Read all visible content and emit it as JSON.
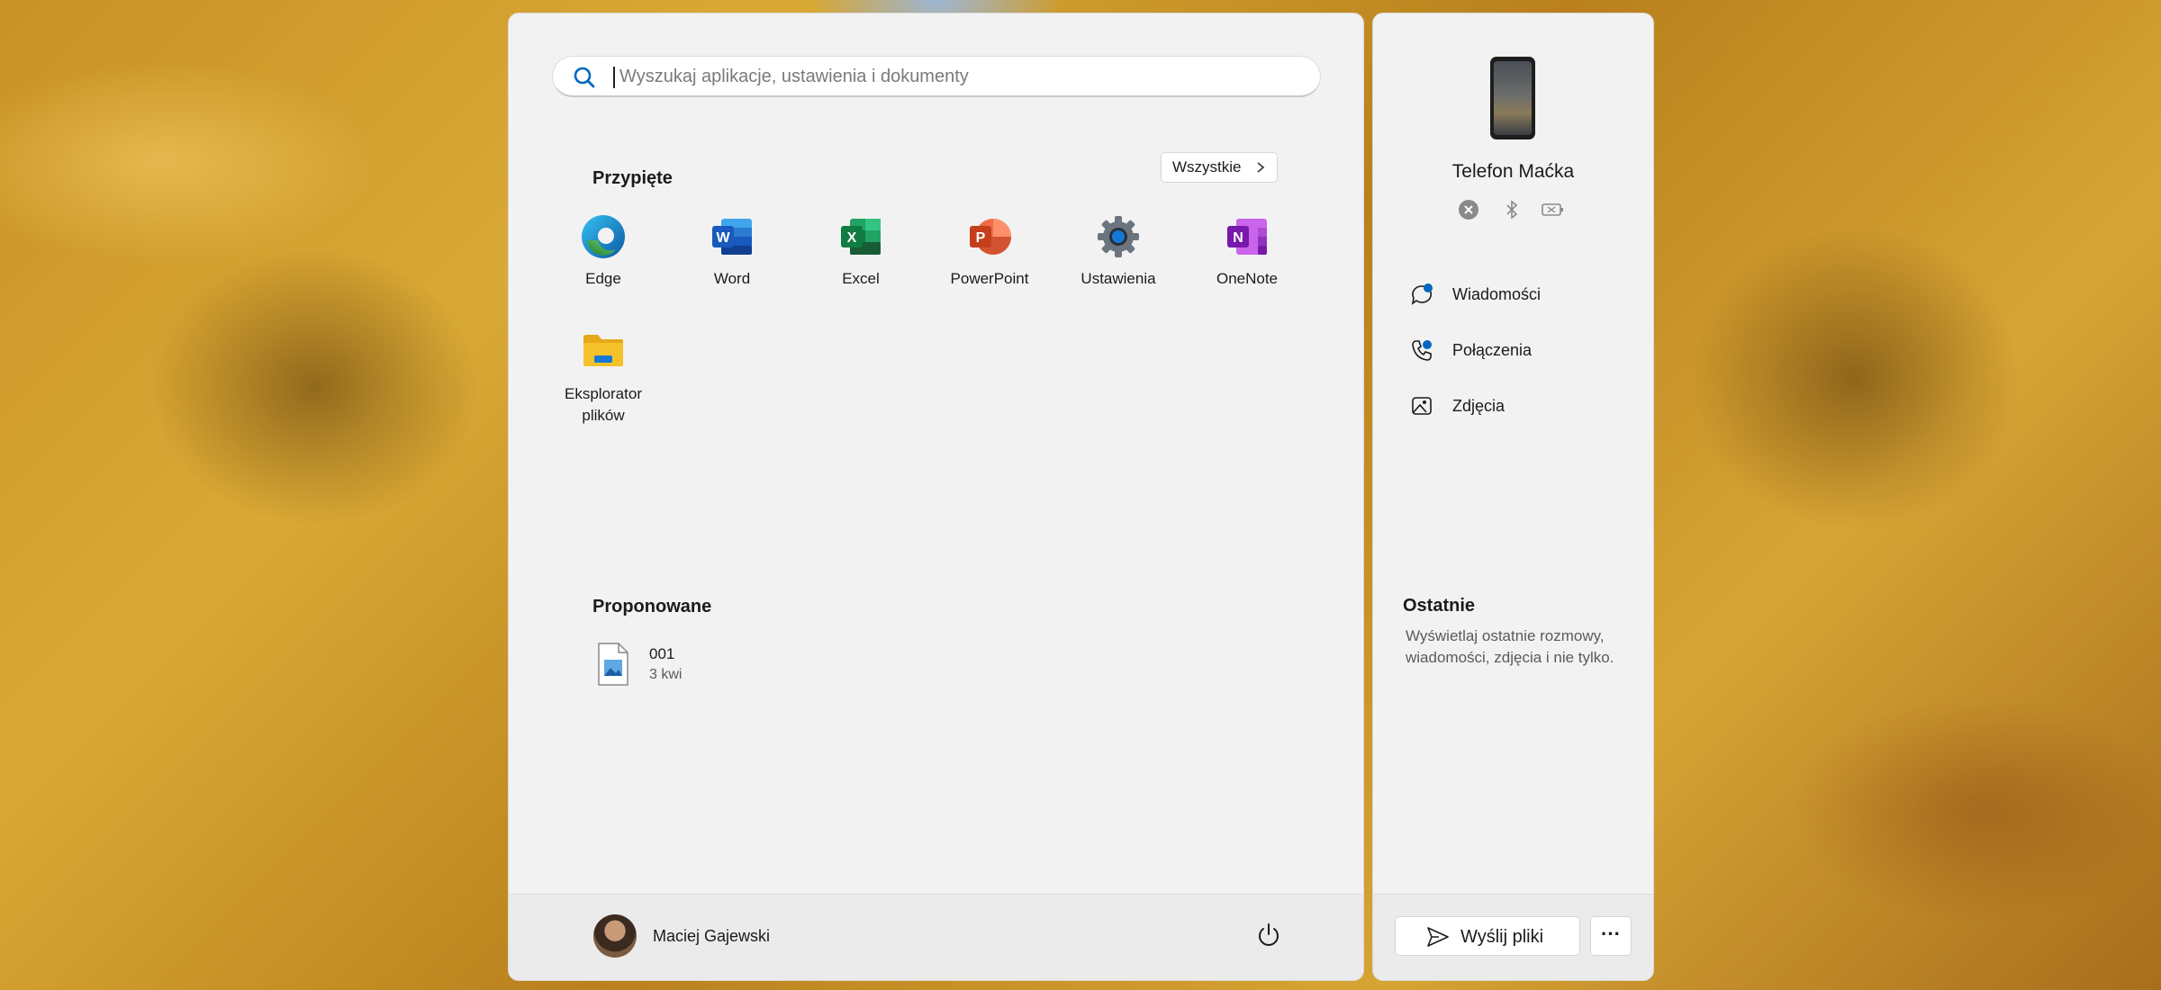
{
  "search": {
    "placeholder": "Wyszukaj aplikacje, ustawienia i dokumenty"
  },
  "pinned": {
    "title": "Przypięte",
    "all_button": "Wszystkie",
    "apps": [
      {
        "label": "Edge",
        "icon": "edge-icon"
      },
      {
        "label": "Word",
        "icon": "word-icon"
      },
      {
        "label": "Excel",
        "icon": "excel-icon"
      },
      {
        "label": "PowerPoint",
        "icon": "powerpoint-icon"
      },
      {
        "label": "Ustawienia",
        "icon": "settings-icon"
      },
      {
        "label": "OneNote",
        "icon": "onenote-icon"
      },
      {
        "label": "Eksplorator plików",
        "icon": "file-explorer-icon"
      }
    ]
  },
  "recommended": {
    "title": "Proponowane",
    "items": [
      {
        "name": "001",
        "date": "3 kwi",
        "icon": "image-file-icon"
      }
    ]
  },
  "user": {
    "name": "Maciej Gajewski"
  },
  "phone": {
    "name": "Telefon Maćka",
    "nav": [
      {
        "label": "Wiadomości",
        "icon": "messages-icon"
      },
      {
        "label": "Połączenia",
        "icon": "calls-icon"
      },
      {
        "label": "Zdjęcia",
        "icon": "photos-icon"
      }
    ],
    "recent_title": "Ostatnie",
    "recent_desc": "Wyświetlaj ostatnie rozmowy, wiadomości, zdjęcia i nie tylko.",
    "send_button": "Wyślij pliki",
    "more_button": "···"
  },
  "colors": {
    "accent": "#0067c0",
    "word": "#185abd",
    "excel": "#107c41",
    "powerpoint": "#c43e1c",
    "onenote": "#7719aa",
    "folder": "#f4c22b"
  }
}
